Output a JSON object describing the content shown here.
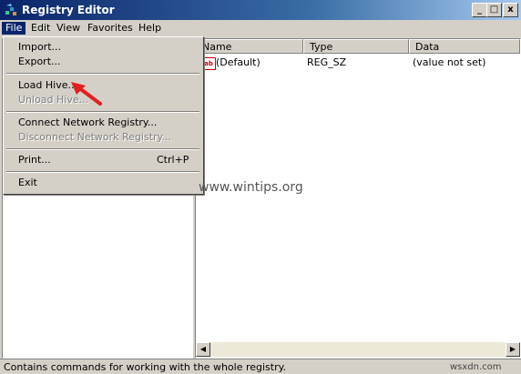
{
  "window": {
    "title": "Registry Editor",
    "min_glyph": "_",
    "max_glyph": "□",
    "close_glyph": "x"
  },
  "menubar": {
    "items": [
      "File",
      "Edit",
      "View",
      "Favorites",
      "Help"
    ]
  },
  "file_menu": {
    "import": "Import...",
    "export": "Export...",
    "load_hive": "Load Hive...",
    "unload_hive": "Unload Hive...",
    "connect": "Connect Network Registry...",
    "disconnect": "Disconnect Network Registry...",
    "print": "Print...",
    "print_shortcut": "Ctrl+P",
    "exit": "Exit"
  },
  "list": {
    "headers": [
      "Name",
      "Type",
      "Data"
    ],
    "rows": [
      {
        "icon": "string-value-icon",
        "icon_text": "ab",
        "name": "(Default)",
        "type": "REG_SZ",
        "data": "(value not set)"
      }
    ]
  },
  "status": "Contains commands for working with the whole registry.",
  "watermark": "www.wintips.org",
  "corner_mark": "wsxdn.com",
  "colors": {
    "title_bar": "#0a246a",
    "menu_highlight": "#0a246a",
    "arrow": "#e02020"
  }
}
